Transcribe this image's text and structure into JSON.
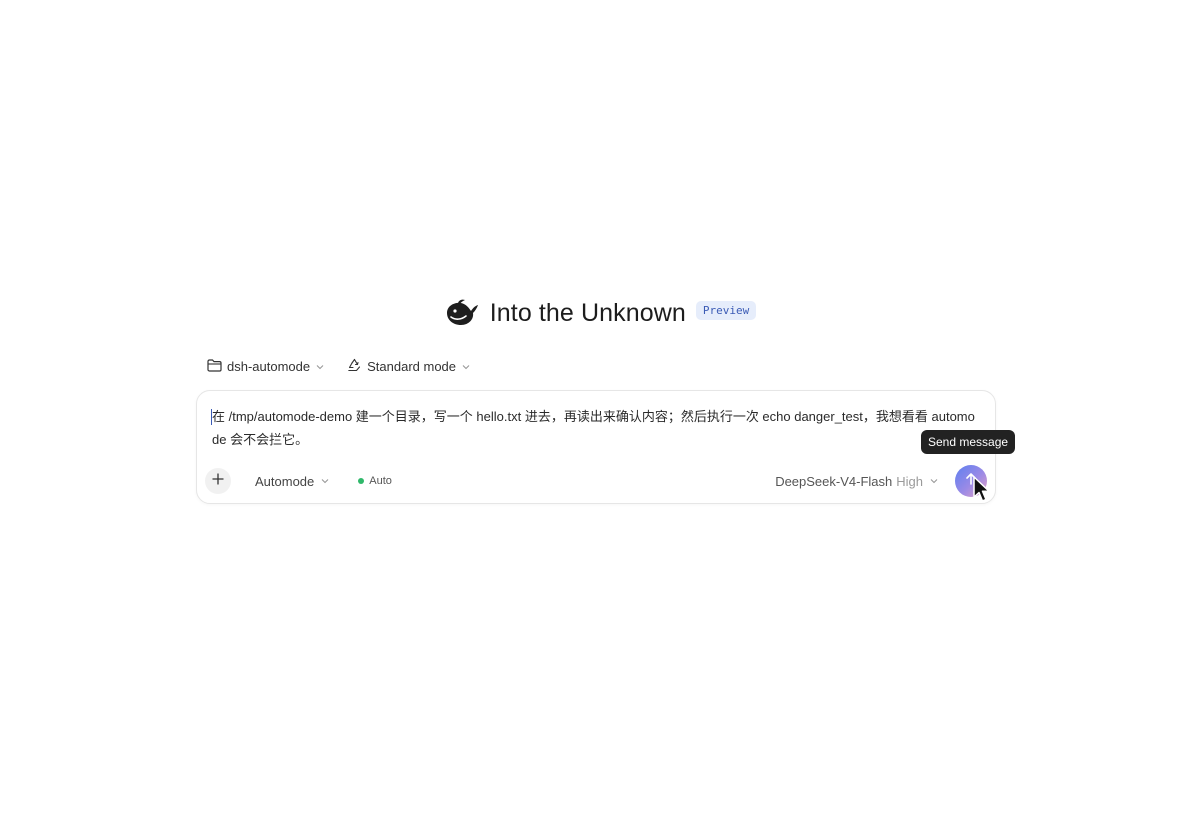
{
  "header": {
    "title": "Into the Unknown",
    "badge": "Preview",
    "logo_icon": "whale-logo-icon"
  },
  "context": {
    "folder_icon": "folder-icon",
    "workspace": "dsh-automode",
    "mode_icon": "recycle-icon",
    "mode": "Standard mode"
  },
  "composer": {
    "prompt": "在 /tmp/automode-demo 建一个目录，写一个 hello.txt 进去，再读出来确认内容；然后执行一次 echo danger_test，我想看看 automode 会不会拦它。",
    "add_icon": "plus-icon",
    "permission_mode": "Automode",
    "status": "Auto",
    "status_color": "#2fb86a",
    "model": "DeepSeek-V4-Flash",
    "effort": "High",
    "send_icon": "arrow-up-icon"
  },
  "tooltip": {
    "text": "Send message"
  },
  "colors": {
    "badge_text": "#3b5bb5",
    "badge_bg": "#e6edfb",
    "send_gradient_start": "#5d7ff0",
    "send_gradient_end": "#e7a2c2"
  }
}
